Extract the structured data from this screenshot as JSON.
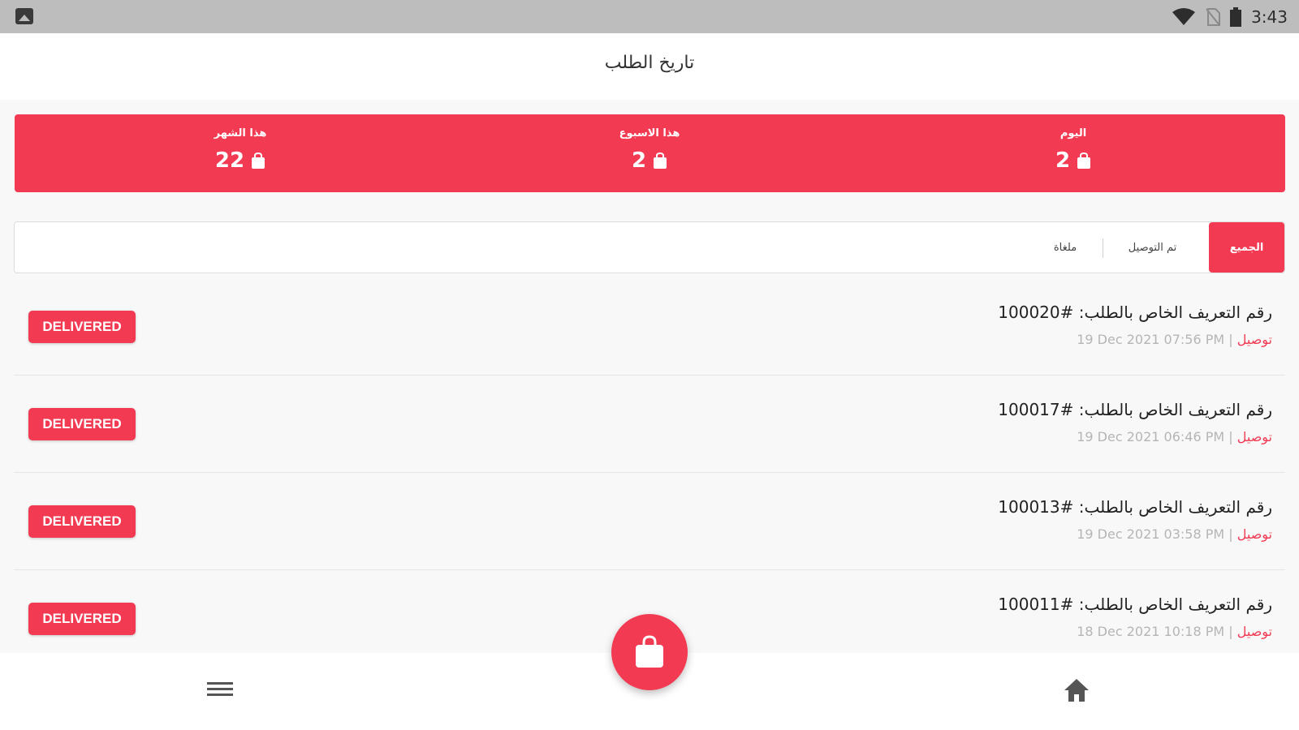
{
  "status_bar": {
    "time": "3:43",
    "icons": [
      "gallery-icon",
      "wifi-icon",
      "no-sim-icon",
      "battery-icon"
    ]
  },
  "header": {
    "title": "تاريخ الطلب"
  },
  "stats": [
    {
      "label": "هذا الشهر",
      "value": "22",
      "icon": "bag-icon"
    },
    {
      "label": "هذا الاسبوع",
      "value": "2",
      "icon": "bag-icon"
    },
    {
      "label": "اليوم",
      "value": "2",
      "icon": "bag-icon"
    }
  ],
  "filters": {
    "all": "الجميع",
    "delivered": "تم التوصيل",
    "canceled": "ملغاة"
  },
  "orders": [
    {
      "id_text": "رقم التعريف الخاص بالطلب: #100020",
      "date": "19 Dec 2021  07:56 PM",
      "type": "توصيل",
      "status": "DELIVERED"
    },
    {
      "id_text": "رقم التعريف الخاص بالطلب: #100017",
      "date": "19 Dec 2021  06:46 PM",
      "type": "توصيل",
      "status": "DELIVERED"
    },
    {
      "id_text": "رقم التعريف الخاص بالطلب: #100013",
      "date": "19 Dec 2021  03:58 PM",
      "type": "توصيل",
      "status": "DELIVERED"
    },
    {
      "id_text": "رقم التعريف الخاص بالطلب: #100011",
      "date": "18 Dec 2021  10:18 PM",
      "type": "توصيل",
      "status": "DELIVERED"
    }
  ],
  "nav": {
    "left_icon": "menu-icon",
    "center_icon": "shopping-bag-icon",
    "right_icon": "home-icon"
  },
  "colors": {
    "accent": "#f23a52",
    "status_bar": "#bdbdbd"
  }
}
